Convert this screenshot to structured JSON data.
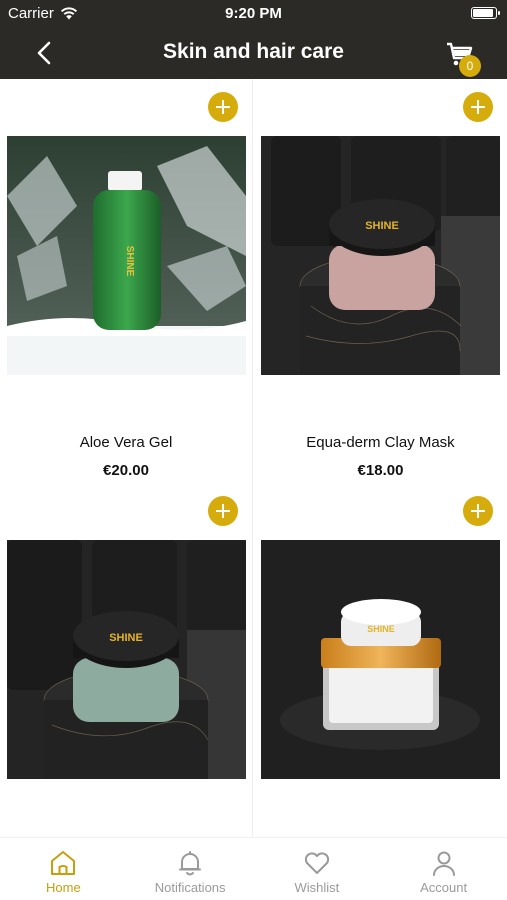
{
  "status_bar": {
    "carrier": "Carrier",
    "time": "9:20 PM",
    "battery_level": 0.95
  },
  "nav": {
    "title": "Skin and hair care",
    "cart_count": "0",
    "back_icon": "chevron-left-icon",
    "cart_icon": "cart-icon"
  },
  "products": [
    {
      "name": "Aloe Vera Gel",
      "price": "€20.00",
      "brand_text": "SHINE"
    },
    {
      "name": "Equa-derm Clay Mask",
      "price": "€18.00",
      "brand_text": "SHINE"
    },
    {
      "name": "",
      "price": "",
      "brand_text": "SHINE"
    },
    {
      "name": "",
      "price": "",
      "brand_text": "SHINE"
    }
  ],
  "tabs": [
    {
      "label": "Home",
      "icon": "home-icon",
      "active": true
    },
    {
      "label": "Notifications",
      "icon": "bell-icon",
      "active": false
    },
    {
      "label": "Wishlist",
      "icon": "heart-icon",
      "active": false
    },
    {
      "label": "Account",
      "icon": "person-icon",
      "active": false
    }
  ],
  "colors": {
    "accent": "#d6ac0d",
    "header_bg": "#2b2a26",
    "active_tab": "#c99e0b",
    "inactive_tab": "#9a9a9a"
  }
}
